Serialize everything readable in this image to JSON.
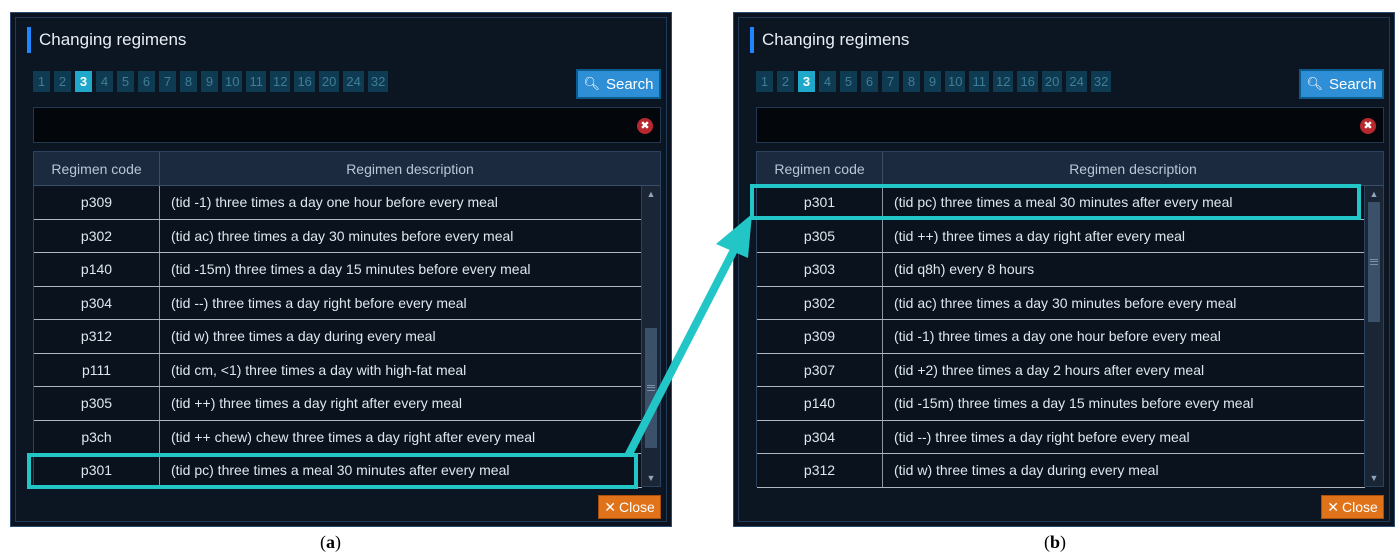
{
  "panels": [
    {
      "caption_open": "(",
      "caption_letter": "a",
      "caption_close": ")",
      "title": "Changing regimens",
      "pages": [
        "1",
        "2",
        "3",
        "4",
        "5",
        "6",
        "7",
        "8",
        "9",
        "10",
        "11",
        "12",
        "16",
        "20",
        "24",
        "32"
      ],
      "active_page": "3",
      "search_label": "Search",
      "search_value": "",
      "headers": {
        "code": "Regimen code",
        "description": "Regimen description"
      },
      "rows": [
        {
          "code": "p309",
          "desc": "(tid -1) three times a day one hour before every meal"
        },
        {
          "code": "p302",
          "desc": "(tid ac) three times a day 30 minutes before every meal"
        },
        {
          "code": "p140",
          "desc": "(tid -15m) three times a day 15 minutes before every meal"
        },
        {
          "code": "p304",
          "desc": "(tid --) three times a day right before every meal"
        },
        {
          "code": "p312",
          "desc": "(tid w) three times a day during every meal"
        },
        {
          "code": "p111",
          "desc": "(tid cm, <1) three times a day with high-fat meal"
        },
        {
          "code": "p305",
          "desc": "(tid ++) three times a day right after every meal"
        },
        {
          "code": "p3ch",
          "desc": "(tid ++ chew) chew three times a day right after every meal"
        },
        {
          "code": "p301",
          "desc": "(tid pc) three times a meal 30 minutes after every meal"
        }
      ],
      "highlighted_row": 8,
      "scroll_position": 0.85,
      "close_label": "Close"
    },
    {
      "caption_open": "(",
      "caption_letter": "b",
      "caption_close": ")",
      "title": "Changing regimens",
      "pages": [
        "1",
        "2",
        "3",
        "4",
        "5",
        "6",
        "7",
        "8",
        "9",
        "10",
        "11",
        "12",
        "16",
        "20",
        "24",
        "32"
      ],
      "active_page": "3",
      "search_label": "Search",
      "search_value": "",
      "headers": {
        "code": "Regimen code",
        "description": "Regimen description"
      },
      "rows": [
        {
          "code": "p301",
          "desc": "(tid pc) three times a meal 30 minutes after every meal"
        },
        {
          "code": "p305",
          "desc": "(tid ++) three times a day right after every meal"
        },
        {
          "code": "p303",
          "desc": "(tid q8h) every 8 hours"
        },
        {
          "code": "p302",
          "desc": "(tid ac) three times a day 30 minutes before every meal"
        },
        {
          "code": "p309",
          "desc": "(tid -1) three times a day one hour before every meal"
        },
        {
          "code": "p307",
          "desc": "(tid +2) three times a day 2 hours after every meal"
        },
        {
          "code": "p140",
          "desc": "(tid -15m) three times a day 15 minutes before every meal"
        },
        {
          "code": "p304",
          "desc": "(tid --) three times a day right before every meal"
        },
        {
          "code": "p312",
          "desc": "(tid w) three times a day during every meal"
        }
      ],
      "highlighted_row": 0,
      "scroll_position": 0.0,
      "close_label": "Close"
    }
  ],
  "colors": {
    "highlight": "#22c6c6",
    "accent": "#1f86ff",
    "search_button": "#2e8ed6",
    "close_button": "#e0731a",
    "panel_bg": "#0b1320"
  }
}
